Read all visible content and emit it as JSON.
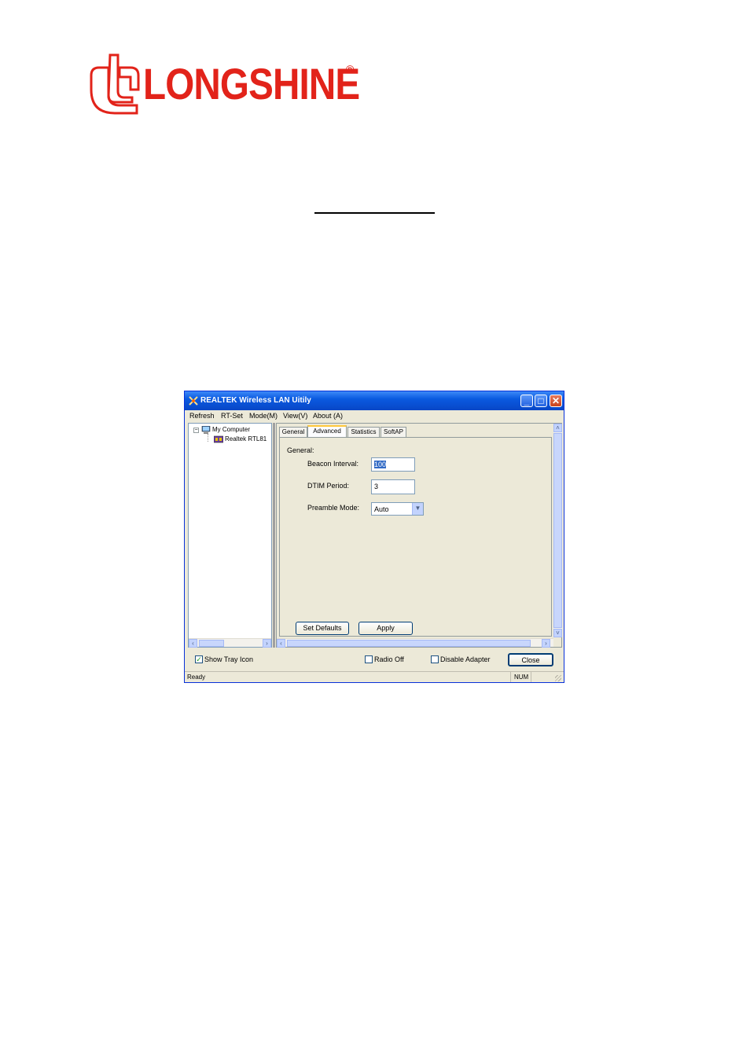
{
  "logo": {
    "brand": "LONGSHINE",
    "registered": "®"
  },
  "window": {
    "title": "REALTEK Wireless LAN Uitily",
    "controls": {
      "minimize": "_",
      "maximize": "□",
      "close": "✕"
    }
  },
  "menu": [
    {
      "label": "Refresh"
    },
    {
      "label": "RT-Set"
    },
    {
      "label": "Mode(M)"
    },
    {
      "label": "View(V)"
    },
    {
      "label": "About (A)"
    }
  ],
  "tree": {
    "root": "My Computer",
    "root_expander": "−",
    "child": "Realtek RTL81"
  },
  "tabs": [
    {
      "label": "General",
      "active": false
    },
    {
      "label": "Advanced",
      "active": true
    },
    {
      "label": "Statistics",
      "active": false
    },
    {
      "label": "SoftAP",
      "active": false
    }
  ],
  "advanced": {
    "group_label": "General:",
    "beacon_interval_label": "Beacon Interval:",
    "beacon_interval_value": "100",
    "dtim_period_label": "DTIM Period:",
    "dtim_period_value": "3",
    "preamble_mode_label": "Preamble Mode:",
    "preamble_mode_value": "Auto",
    "set_defaults": "Set Defaults",
    "apply": "Apply"
  },
  "bottom": {
    "show_tray_icon": {
      "label": "Show Tray Icon",
      "checked": true,
      "mark": "✓"
    },
    "radio_off": {
      "label": "Radio Off",
      "checked": false
    },
    "disable_adapter": {
      "label": "Disable Adapter",
      "checked": false
    },
    "close": "Close"
  },
  "statusbar": {
    "text": "Ready",
    "num": "NUM"
  },
  "colors": {
    "brand_red": "#e2231a",
    "xp_blue": "#0a5ae0"
  }
}
